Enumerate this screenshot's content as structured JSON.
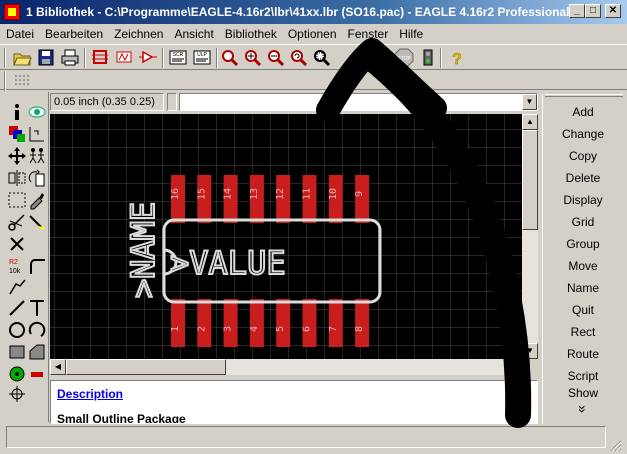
{
  "window": {
    "title": "1 Bibliothek - C:\\Programme\\EAGLE-4.16r2\\lbr\\41xx.lbr (SO16.pac) - EAGLE 4.16r2 Professional",
    "minimize": "_",
    "maximize": "□",
    "close": "✕"
  },
  "menu": [
    {
      "label": "Datei"
    },
    {
      "label": "Bearbeiten"
    },
    {
      "label": "Zeichnen"
    },
    {
      "label": "Ansicht"
    },
    {
      "label": "Bibliothek"
    },
    {
      "label": "Optionen"
    },
    {
      "label": "Fenster"
    },
    {
      "label": "Hilfe"
    }
  ],
  "toolbar": {
    "script_label": "SCR",
    "ulp_label": "ULP",
    "stop_label": "STOP",
    "help_label": "?"
  },
  "coords": {
    "readout": "0.05 inch (0.35 0.25)"
  },
  "canvas": {
    "name_label": ">NAME",
    "value_label": ">VALUE",
    "top_pins": [
      "16",
      "15",
      "14",
      "13",
      "12",
      "11",
      "10",
      "9"
    ],
    "bottom_pins": [
      "1",
      "2",
      "3",
      "4",
      "5",
      "6",
      "7",
      "8"
    ],
    "colors": {
      "background": "#000000",
      "grid": "#4a4a4a",
      "pad": "#c81e1e",
      "silk": "#dcdcdc"
    }
  },
  "description": {
    "link": "Description",
    "text": "Small Outline Package"
  },
  "commands": [
    "Add",
    "Change",
    "Copy",
    "Delete",
    "Display",
    "Grid",
    "Group",
    "Move",
    "Name",
    "Quit",
    "Rect",
    "Route",
    "Script",
    "Show"
  ],
  "commands_more": "»"
}
